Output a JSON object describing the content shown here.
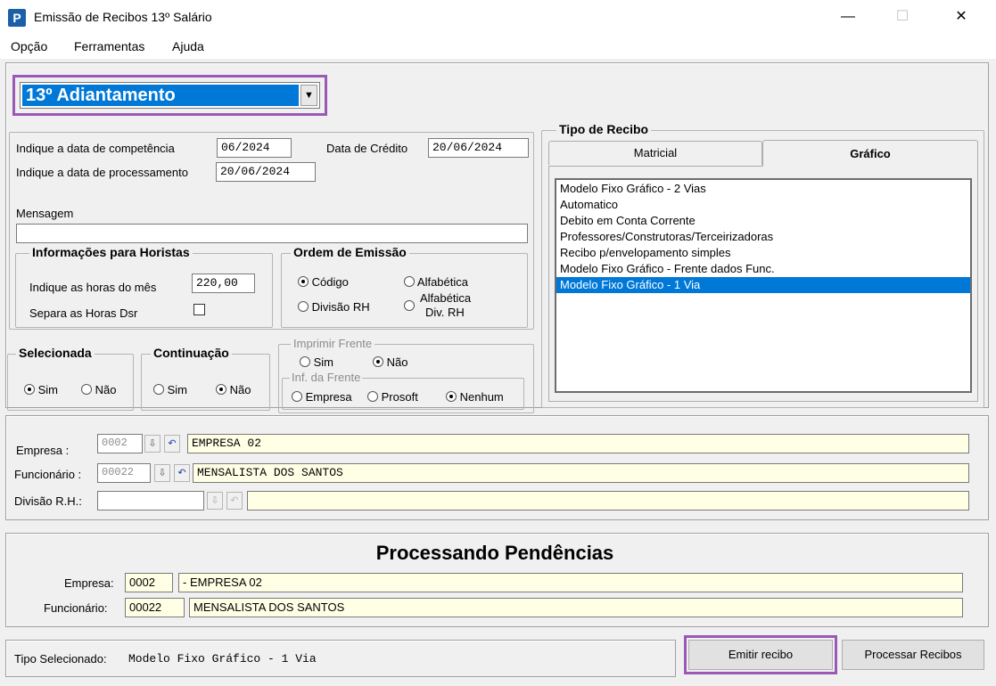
{
  "window": {
    "title": "Emissão de Recibos 13º Salário",
    "icon_letter": "P",
    "minimize": "—",
    "maximize": "☐",
    "close": "✕"
  },
  "menu": [
    "Opção",
    "Ferramentas",
    "Ajuda"
  ],
  "dropdown": {
    "value": "13º Adiantamento",
    "arrow": "▼"
  },
  "dates": {
    "competencia_label": "Indique a data de competência",
    "competencia_value": "06/2024",
    "credito_label": "Data de Crédito",
    "credito_value": "20/06/2024",
    "processamento_label": "Indique a data de processamento",
    "processamento_value": "20/06/2024"
  },
  "mensagem": {
    "label": "Mensagem",
    "value": ""
  },
  "horistas": {
    "title": "Informações para Horistas",
    "horas_label": "Indique as horas do mês",
    "horas_value": "220,00",
    "separa_label": "Separa as Horas Dsr"
  },
  "ordem": {
    "title": "Ordem de Emissão",
    "codigo": "Código",
    "alfabetica": "Alfabética",
    "divisao": "Divisão RH",
    "alfa_div_1": "Alfabética",
    "alfa_div_2": "Div. RH"
  },
  "selecionada": {
    "title": "Selecionada",
    "sim": "Sim",
    "nao": "Não"
  },
  "continuacao": {
    "title": "Continuação",
    "sim": "Sim",
    "nao": "Não"
  },
  "imprimir_frente": {
    "title": "Imprimir Frente",
    "sim": "Sim",
    "nao": "Não"
  },
  "inf_frente": {
    "title": "Inf. da Frente",
    "empresa": "Empresa",
    "prosoft": "Prosoft",
    "nenhum": "Nenhum"
  },
  "tipo_recibo": {
    "title": "Tipo de Recibo",
    "tab_matricial": "Matricial",
    "tab_grafico": "Gráfico",
    "items": [
      "Modelo Fixo Gráfico - 2 Vias",
      "Automatico",
      "Debito em Conta Corrente",
      "Professores/Construtoras/Terceirizadoras",
      "Recibo p/envelopamento simples",
      "Modelo Fixo Gráfico - Frente dados Func.",
      "Modelo Fixo Gráfico - 1 Via"
    ],
    "selected_index": 6
  },
  "filtros": {
    "empresa_label": "Empresa :",
    "empresa_code": "0002",
    "empresa_name": "EMPRESA 02",
    "funcionario_label": "Funcionário :",
    "funcionario_code": "00022",
    "funcionario_name": "MENSALISTA DOS SANTOS",
    "divisao_label": "Divisão R.H.:",
    "divisao_code": "",
    "divisao_name": ""
  },
  "pendencias": {
    "title": "Processando Pendências",
    "empresa_label": "Empresa:",
    "empresa_code": "0002",
    "empresa_name": "- EMPRESA 02",
    "funcionario_label": "Funcionário:",
    "funcionario_code": "00022",
    "funcionario_name": "MENSALISTA DOS SANTOS"
  },
  "status": {
    "label": "Tipo Selecionado:",
    "value": "Modelo Fixo Gráfico - 1 Via"
  },
  "buttons": {
    "emitir": "Emitir recibo",
    "processar": "Processar Recibos"
  },
  "colors": {
    "selection": "#0078d7",
    "highlight": "#9b59b6",
    "readonly_field": "#ffffe6"
  }
}
